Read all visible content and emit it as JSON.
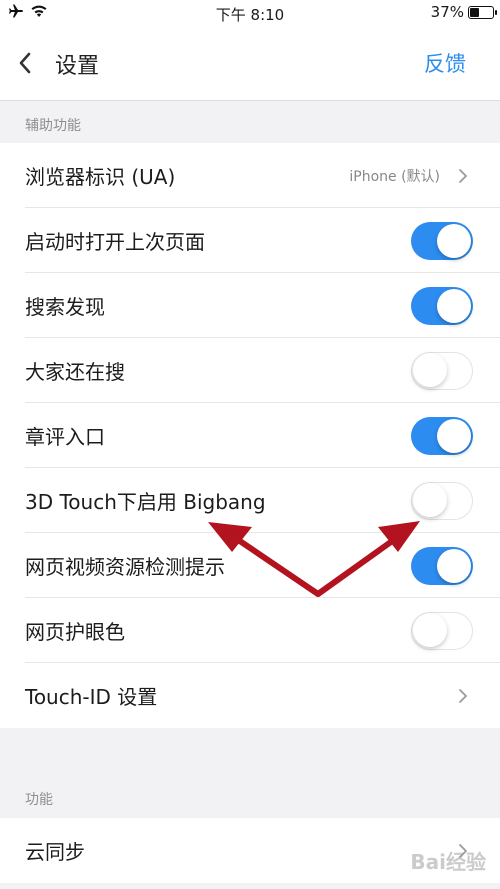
{
  "status_bar": {
    "time": "下午 8:10",
    "battery": "37%",
    "battery_level": 0.37
  },
  "nav": {
    "title": "设置",
    "feedback": "反馈"
  },
  "sections": [
    {
      "header": "辅助功能",
      "rows": [
        {
          "label": "浏览器标识 (UA)",
          "type": "link",
          "value": "iPhone (默认)"
        },
        {
          "label": "启动时打开上次页面",
          "type": "toggle",
          "on": true
        },
        {
          "label": "搜索发现",
          "type": "toggle",
          "on": true
        },
        {
          "label": "大家还在搜",
          "type": "toggle",
          "on": false
        },
        {
          "label": "章评入口",
          "type": "toggle",
          "on": true
        },
        {
          "label": "3D Touch下启用 Bigbang",
          "type": "toggle",
          "on": false
        },
        {
          "label": "网页视频资源检测提示",
          "type": "toggle",
          "on": true
        },
        {
          "label": "网页护眼色",
          "type": "toggle",
          "on": false
        },
        {
          "label": "Touch-ID 设置",
          "type": "link"
        }
      ]
    },
    {
      "header": "功能",
      "rows": [
        {
          "label": "云同步",
          "type": "link"
        }
      ]
    }
  ],
  "colors": {
    "accent": "#2d8cf0",
    "annotation_arrow": "#b3121f"
  },
  "icons": {
    "back": "chevron-left-icon",
    "row_link": "chevron-right-icon",
    "airplane": "airplane-icon",
    "wifi": "wifi-icon",
    "battery": "battery-icon"
  },
  "watermark": "Bai经验"
}
